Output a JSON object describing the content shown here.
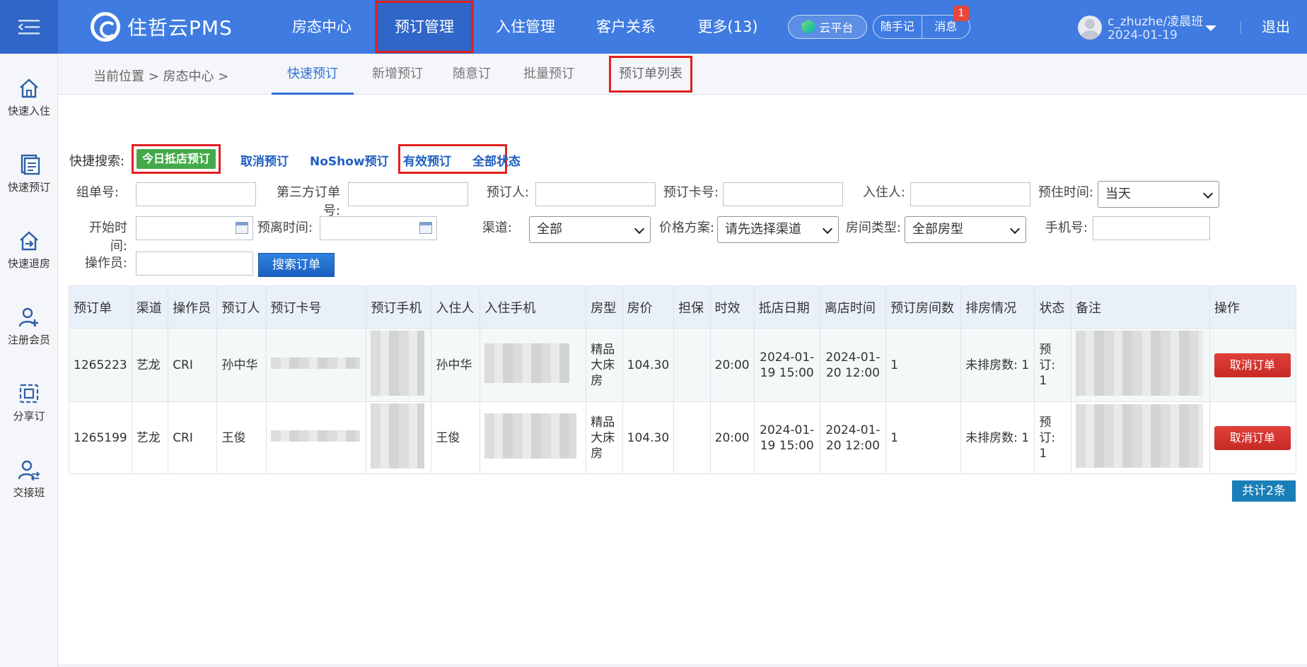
{
  "header": {
    "logo_text": "住哲云PMS",
    "nav": [
      "房态中心",
      "预订管理",
      "入住管理",
      "客户关系",
      "更多(13)"
    ],
    "cloud": "云平台",
    "notes": "随手记",
    "messages": "消息",
    "message_count": "1",
    "user_name": "c_zhuzhe/凌晨班",
    "user_date": "2024-01-19",
    "logout": "退出"
  },
  "sidebar": [
    "快速入住",
    "快速预订",
    "快速退房",
    "注册会员",
    "分享订",
    "交接班"
  ],
  "breadcrumb": "当前位置 > 房态中心 >",
  "tabs": [
    "快速预订",
    "新增预订",
    "随意订",
    "批量预订",
    "预订单列表"
  ],
  "quick": {
    "label": "快捷搜索:",
    "today": "今日抵店预订",
    "cancel": "取消预订",
    "noshow": "NoShow预订",
    "valid": "有效预订",
    "all": "全部状态"
  },
  "filters": {
    "group_no": "组单号:",
    "third_no": "第三方订单号:",
    "booker": "预订人:",
    "card_no": "预订卡号:",
    "guest": "入住人:",
    "stay_time": "预住时间:",
    "stay_time_value": "当天",
    "start_time": "开始时间:",
    "leave_time": "预离时间:",
    "channel": "渠道:",
    "channel_value": "全部",
    "price_plan": "价格方案:",
    "price_plan_value": "请先选择渠道",
    "room_type": "房间类型:",
    "room_type_value": "全部房型",
    "phone": "手机号:",
    "operator": "操作员:",
    "search_button": "搜索订单"
  },
  "table": {
    "headers": [
      "预订单",
      "渠道",
      "操作员",
      "预订人",
      "预订卡号",
      "预订手机",
      "入住人",
      "入住手机",
      "房型",
      "房价",
      "担保",
      "时效",
      "抵店日期",
      "离店时间",
      "预订房间数",
      "排房情况",
      "状态",
      "备注",
      "操作"
    ],
    "rows": [
      {
        "id": "1265223",
        "channel": "艺龙",
        "operator": "CRI",
        "booker": "孙中华",
        "guest": "孙中华",
        "room_type": "精品大床房",
        "price": "104.30",
        "timing": "20:00",
        "arrive": "2024-01-19 15:00",
        "leave": "2024-01-20 12:00",
        "rooms": "1",
        "assign": "未排房数: 1",
        "status": "预订: 1",
        "action": "取消订单"
      },
      {
        "id": "1265199",
        "channel": "艺龙",
        "operator": "CRI",
        "booker": "王俊",
        "guest": "王俊",
        "room_type": "精品大床房",
        "price": "104.30",
        "timing": "20:00",
        "arrive": "2024-01-19 15:00",
        "leave": "2024-01-20 12:00",
        "rooms": "1",
        "assign": "未排房数: 1",
        "status": "预订: 1",
        "action": "取消订单"
      }
    ],
    "total": "共计2条"
  },
  "colors": {
    "header": "#3f7be0",
    "accent": "#2f6fd6",
    "highlight": "#e02020",
    "green": "#45a94c",
    "danger": "#c72a25"
  }
}
